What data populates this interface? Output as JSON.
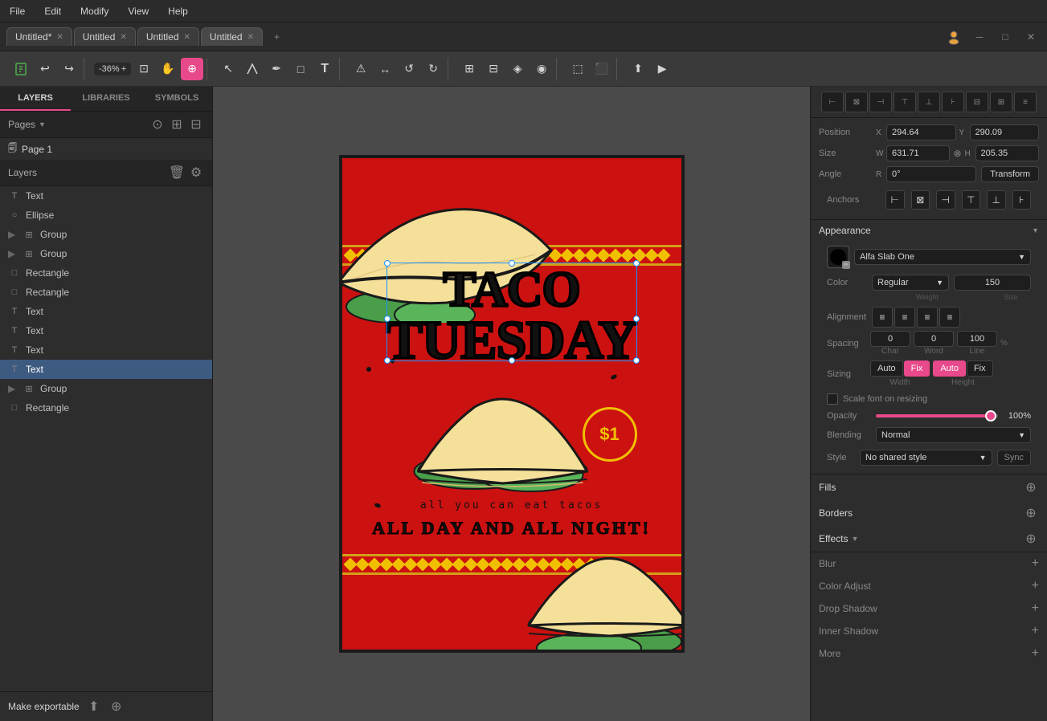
{
  "menu": {
    "items": [
      "File",
      "Edit",
      "Modify",
      "View",
      "Help"
    ]
  },
  "tabs": [
    {
      "label": "Untitled*",
      "active": false
    },
    {
      "label": "Untitled",
      "active": false
    },
    {
      "label": "Untitled",
      "active": false
    },
    {
      "label": "Untitled",
      "active": true
    }
  ],
  "toolbar": {
    "zoom": "-36%",
    "zoom_plus": "+"
  },
  "leftPanel": {
    "tabs": [
      "LAYERS",
      "LIBRARIES",
      "SYMBOLS"
    ],
    "activeTab": "LAYERS",
    "pages": "Pages",
    "page1": "Page 1",
    "layersTitle": "Layers",
    "layers": [
      {
        "icon": "T",
        "label": "Text",
        "indent": false,
        "selected": false
      },
      {
        "icon": "○",
        "label": "Ellipse",
        "indent": false,
        "selected": false
      },
      {
        "icon": "⊞",
        "label": "Group",
        "indent": false,
        "selected": false
      },
      {
        "icon": "⊞",
        "label": "Group",
        "indent": false,
        "selected": false
      },
      {
        "icon": "□",
        "label": "Rectangle",
        "indent": false,
        "selected": false
      },
      {
        "icon": "□",
        "label": "Rectangle",
        "indent": false,
        "selected": false
      },
      {
        "icon": "T",
        "label": "Text",
        "indent": false,
        "selected": false
      },
      {
        "icon": "T",
        "label": "Text",
        "indent": false,
        "selected": false
      },
      {
        "icon": "T",
        "label": "Text",
        "indent": false,
        "selected": false
      },
      {
        "icon": "T",
        "label": "Text",
        "indent": false,
        "selected": true
      },
      {
        "icon": "⊞",
        "label": "Group",
        "indent": false,
        "selected": false
      },
      {
        "icon": "□",
        "label": "Rectangle",
        "indent": false,
        "selected": false
      }
    ],
    "exportLabel": "Make exportable"
  },
  "rightPanel": {
    "position": {
      "label": "Position",
      "x_label": "X",
      "x_value": "294.64",
      "y_label": "Y",
      "y_value": "290.09"
    },
    "size": {
      "label": "Size",
      "w_label": "W",
      "w_value": "631.71",
      "h_label": "H",
      "h_value": "205.35"
    },
    "angle": {
      "label": "Angle",
      "r_label": "R",
      "r_value": "0°",
      "transform_label": "Transform"
    },
    "anchors": {
      "label": "Anchors"
    },
    "appearance": {
      "label": "Appearance"
    },
    "font": {
      "name": "Alfa Slab One"
    },
    "color": {
      "label": "Color",
      "value": "Regular",
      "weight_label": "Weight",
      "size_value": "150",
      "size_label": "Size"
    },
    "alignment": {
      "label": "Alignment"
    },
    "spacing": {
      "label": "Spacing",
      "char": "0",
      "word": "0",
      "line": "100",
      "percent": "%",
      "char_label": "Char",
      "word_label": "Word",
      "line_label": "Line"
    },
    "sizing": {
      "label": "Sizing",
      "width_auto": "Auto",
      "width_fix": "Fix",
      "height_auto": "Auto",
      "height_fix": "Fix",
      "width_label": "Width",
      "height_label": "Height"
    },
    "scaleFont": {
      "label": "Scale font on resizing"
    },
    "opacity": {
      "label": "Opacity",
      "value": "100%"
    },
    "blending": {
      "label": "Blending",
      "value": "Normal"
    },
    "style": {
      "label": "Style",
      "value": "No shared style",
      "sync_label": "Sync"
    },
    "fills": {
      "label": "Fills"
    },
    "borders": {
      "label": "Borders"
    },
    "effects": {
      "label": "Effects"
    },
    "effectItems": [
      {
        "label": "Blur"
      },
      {
        "label": "Color Adjust"
      },
      {
        "label": "Drop Shadow"
      },
      {
        "label": "Inner Shadow"
      },
      {
        "label": "More"
      }
    ]
  },
  "poster": {
    "title1": "TACO",
    "title2": "TUESDAY",
    "subtitle": "all you can eat tacos",
    "tagline": "ALL DAY AND ALL  NIGHT!",
    "price": "$1"
  }
}
